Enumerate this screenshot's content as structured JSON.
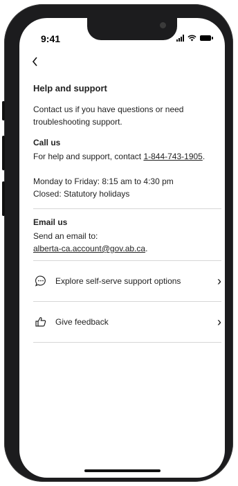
{
  "status_bar": {
    "time": "9:41"
  },
  "nav": {
    "back_icon": "chevron-left-icon",
    "back_glyph": "‹"
  },
  "page": {
    "title": "Help and support",
    "intro": "Contact us if you have questions or need troubleshooting support."
  },
  "call": {
    "heading": "Call us",
    "text_before": "For help and support, contact ",
    "phone": "1-844-743-1905",
    "text_after": ".",
    "hours_line1": "Monday to Friday: 8:15 am to 4:30 pm",
    "hours_line2": "Closed: Statutory holidays"
  },
  "email": {
    "heading": "Email us",
    "text": "Send an email to:",
    "address": "alberta-ca.account@gov.ab.ca",
    "text_after": "."
  },
  "links": [
    {
      "label": "Explore self-serve support options",
      "icon": "chat-bubble-icon"
    },
    {
      "label": "Give feedback",
      "icon": "thumbs-up-icon"
    }
  ],
  "chevron_glyph": "›"
}
